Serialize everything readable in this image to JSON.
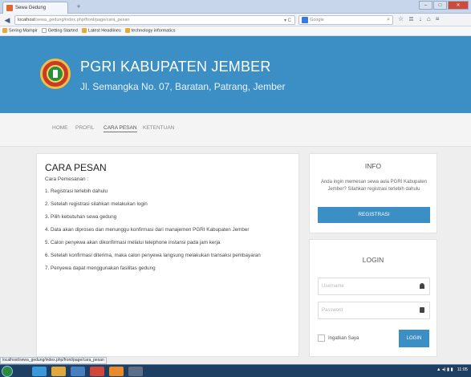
{
  "browser": {
    "tab_title": "Sewa Gedung",
    "new_tab_glyph": "+",
    "url_host": "localhost",
    "url_path": "/sewa_gedung/index.php/front/page/cara_pesan",
    "search_placeholder": "Google",
    "bookmarks": [
      {
        "label": "Sering Mampir",
        "icon": "folder-icon"
      },
      {
        "label": "Getting Started",
        "icon": "page-icon"
      },
      {
        "label": "Latest Headlines",
        "icon": "feed-icon"
      },
      {
        "label": "technology informatics",
        "icon": "page-icon"
      }
    ],
    "status_url": "localhost/sewa_gedung/index.php/front/page/cara_pesan"
  },
  "header": {
    "title": "PGRI KABUPATEN JEMBER",
    "address": "Jl. Semangka No. 07, Baratan, Patrang, Jember"
  },
  "menu": {
    "items": [
      "HOME",
      "PROFIL",
      "CARA PESAN",
      "KETENTUAN"
    ],
    "active": "CARA PESAN"
  },
  "main": {
    "title": "CARA PESAN",
    "subtitle": "Cara Pemesanan :",
    "steps": [
      "1. Registrasi terlebih dahulu",
      "2. Setelah registrasi silahkan melakukan login",
      "3. Pilih kebutuhan sewa gedung",
      "4. Data akan diproses dan menunggu konfirmasi dari manajemen PGRI Kabupaten Jember",
      "5. Calon penyewa akan dikonfirmasi melalui telephone instansi pada jam kerja",
      "6. Setelah konfirmasi diterima, maka calon penyewa langsung melakukan transaksi pembayaran",
      "7. Penyewa dapat menggunakan fasilitas gedung"
    ]
  },
  "info": {
    "title": "INFO",
    "text": "Anda ingin memesan sewa aula PGRI Kabupaten Jember? Silahkan registrasi terlebih dahulu",
    "register_label": "REGISTRASI"
  },
  "login": {
    "title": "LOGIN",
    "username_placeholder": "Username",
    "password_placeholder": "Password",
    "remember_label": "Ingatkan Saya",
    "login_label": "LOGIN"
  },
  "taskbar": {
    "clock": "11:05"
  },
  "colors": {
    "brand_blue": "#3b8fc5",
    "page_bg": "#eeeeee"
  }
}
